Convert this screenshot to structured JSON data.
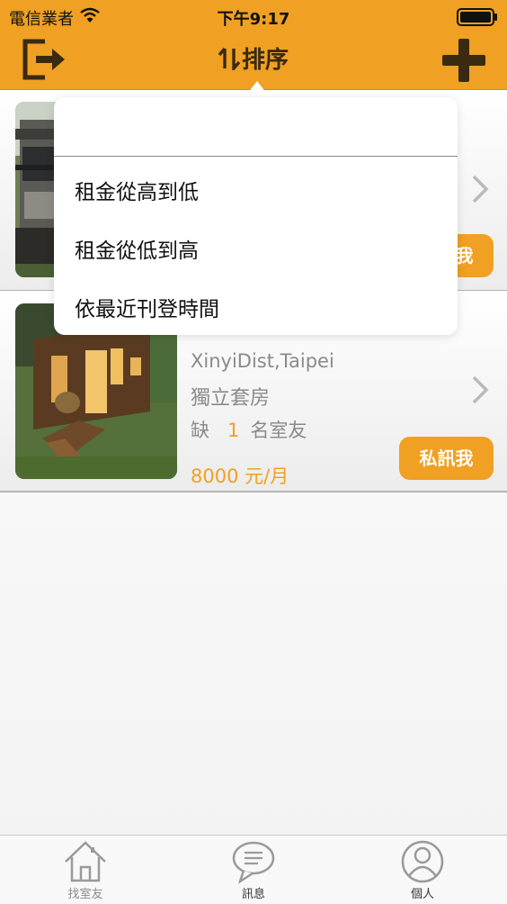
{
  "status_bar": {
    "carrier": "電信業者",
    "time": "下午9:17"
  },
  "nav": {
    "title": "排序",
    "left_icon": "exit-icon",
    "right_icon": "add-icon"
  },
  "sort_menu": {
    "options": [
      "租金從高到低",
      "租金從低到高",
      "依最近刊登時間"
    ]
  },
  "listings": [
    {
      "message_button": "私訊我"
    },
    {
      "location": "XinyiDist,Taipei",
      "room_type": "獨立套房",
      "vacancy_prefix": "缺",
      "vacancy_count": "1",
      "vacancy_suffix": "名室友",
      "price": "8000 元/月",
      "message_button": "私訊我"
    }
  ],
  "tabbar": {
    "items": [
      {
        "label": "找室友",
        "icon": "house-icon"
      },
      {
        "label": "訊息",
        "icon": "chat-bubble-icon"
      },
      {
        "label": "個人",
        "icon": "person-icon"
      }
    ]
  },
  "colors": {
    "accent": "#f0a022",
    "secondary_text": "#8a8a8a"
  }
}
